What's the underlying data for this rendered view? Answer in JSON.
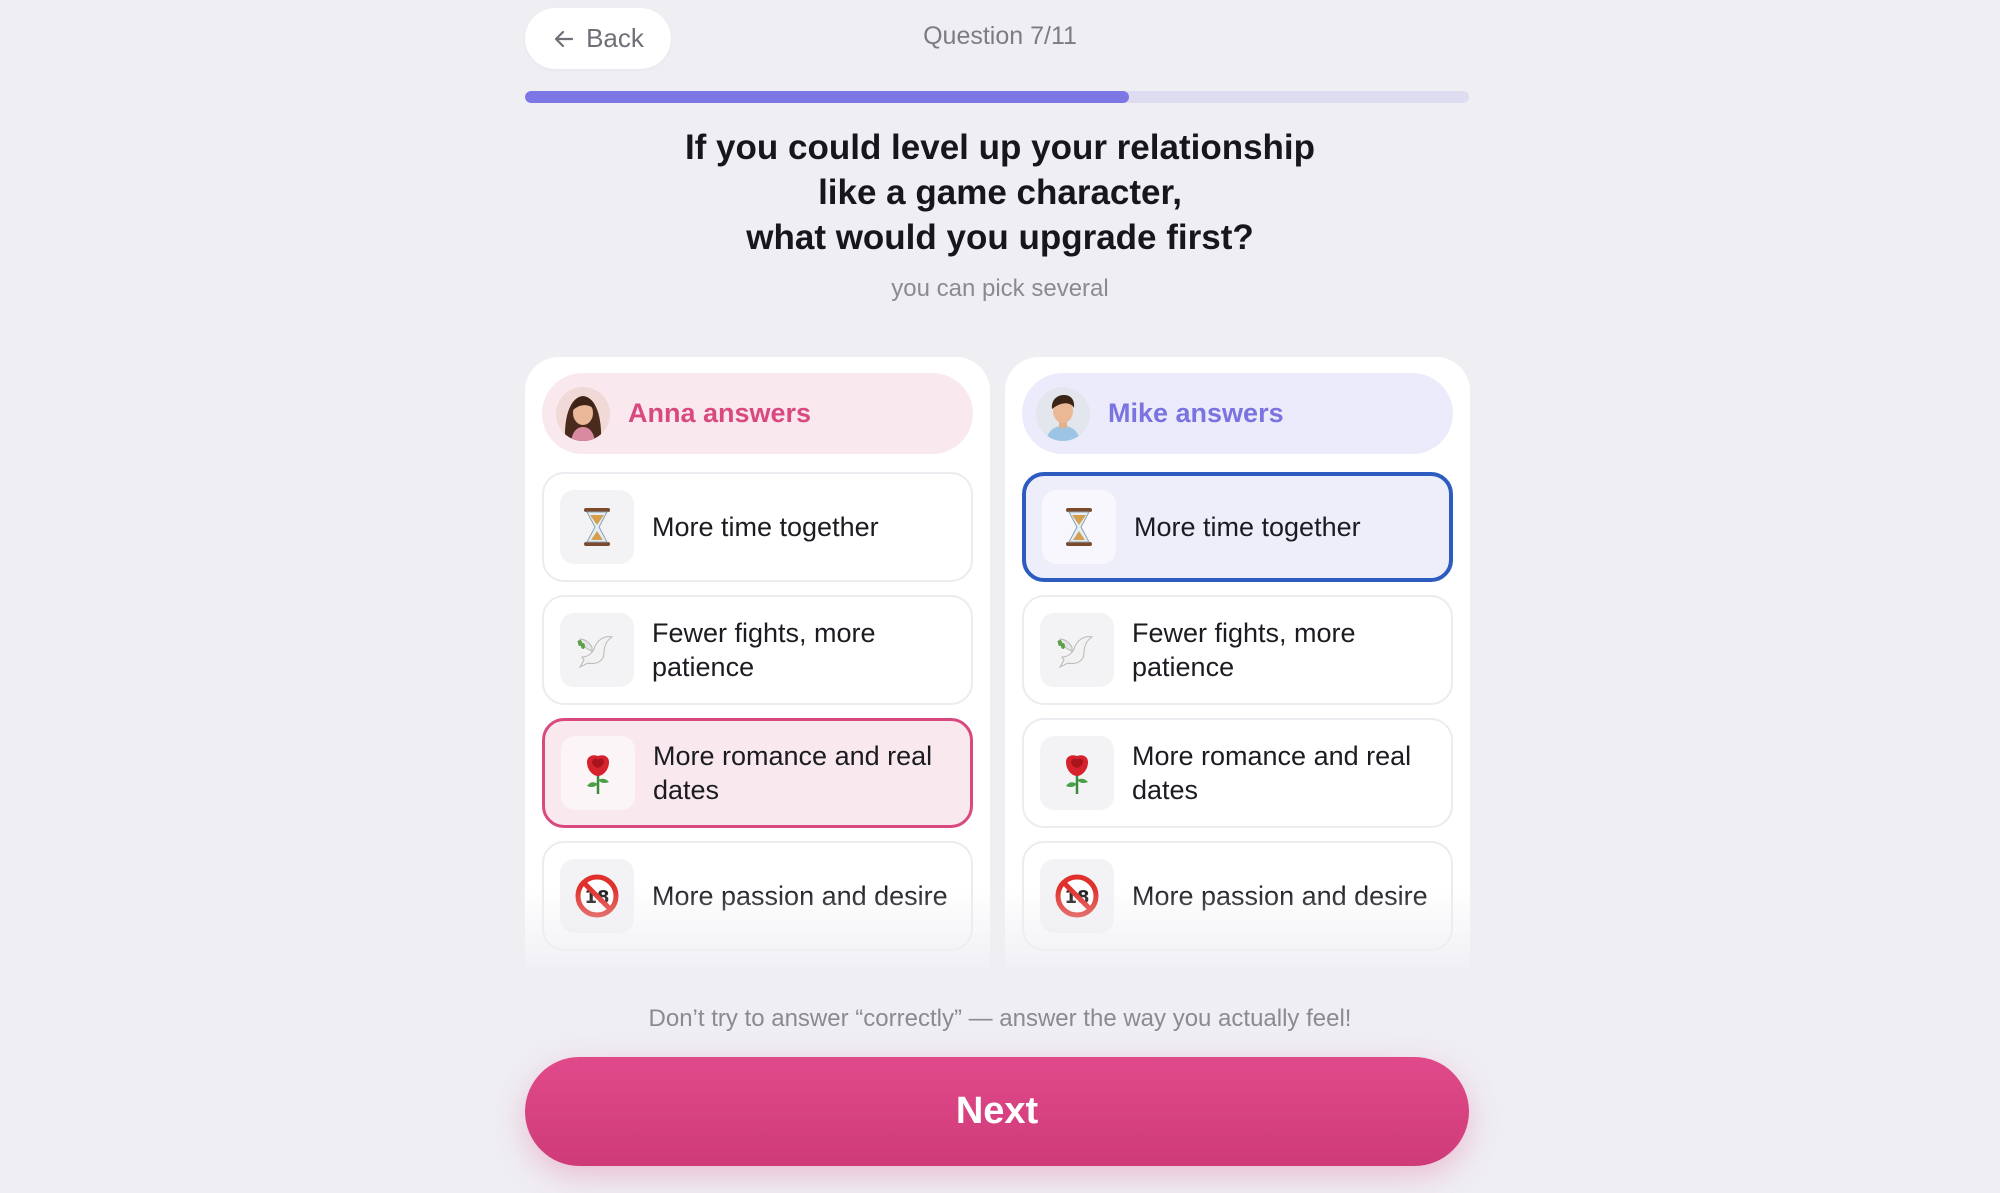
{
  "header": {
    "back_label": "Back",
    "question_counter": "Question 7/11",
    "progress": 0.64
  },
  "question": {
    "title_lines": [
      "If you could level up your relationship",
      "like a game character,",
      "what would you upgrade first?"
    ],
    "subtitle": "you can pick several"
  },
  "partners": [
    {
      "header_label": "Anna answers",
      "accent": "#d9497f",
      "options": [
        {
          "label": "More time together",
          "icon": "hourglass-icon",
          "selected": false
        },
        {
          "label": "Fewer fights, more patience",
          "icon": "dove-icon",
          "selected": false
        },
        {
          "label": "More romance and real dates",
          "icon": "rose-icon",
          "selected": true
        },
        {
          "label": "More passion and desire",
          "icon": "no-under-18-icon",
          "selected": false
        }
      ]
    },
    {
      "header_label": "Mike answers",
      "accent": "#7b73e0",
      "options": [
        {
          "label": "More time together",
          "icon": "hourglass-icon",
          "selected": true
        },
        {
          "label": "Fewer fights, more patience",
          "icon": "dove-icon",
          "selected": false
        },
        {
          "label": "More romance and real dates",
          "icon": "rose-icon",
          "selected": false
        },
        {
          "label": "More passion and desire",
          "icon": "no-under-18-icon",
          "selected": false
        }
      ]
    }
  ],
  "footer": {
    "hint": "Don’t try to answer “correctly” — answer the way you actually feel!",
    "next_label": "Next"
  }
}
